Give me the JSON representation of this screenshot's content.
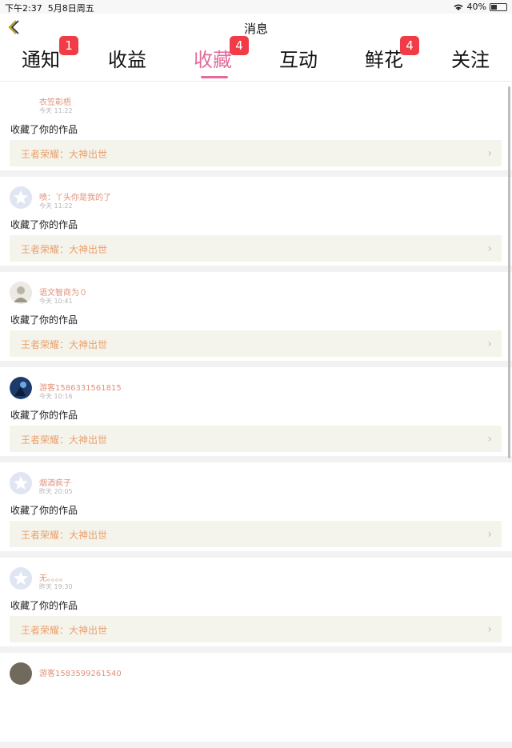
{
  "status": {
    "time": "下午2:37",
    "date": "5月8日周五",
    "battery": "40%",
    "battery_level": 0.4
  },
  "header": {
    "title": "消息",
    "back_icon": "chevron-left-icon"
  },
  "tabs": [
    {
      "label": "通知",
      "badge": "1"
    },
    {
      "label": "收益",
      "badge": ""
    },
    {
      "label": "收藏",
      "badge": "4",
      "active": true
    },
    {
      "label": "互动",
      "badge": ""
    },
    {
      "label": "鲜花",
      "badge": "4"
    },
    {
      "label": "关注",
      "badge": ""
    }
  ],
  "colors": {
    "accent": "#e36b9c",
    "badge": "#f03c46",
    "name": "#e0917a",
    "work_title": "#e9a06b",
    "work_bg": "#f5f4ec"
  },
  "items": [
    {
      "name": "衣笠彰梧",
      "time": "今天 11:22",
      "action": "收藏了你的作品",
      "work": "王者荣耀：大神出世"
    },
    {
      "name": "喷：丫头你是我的了",
      "time": "今天 11:22",
      "action": "收藏了你的作品",
      "work": "王者荣耀：大神出世"
    },
    {
      "name": "语文智商为０",
      "time": "今天 10:41",
      "action": "收藏了你的作品",
      "work": "王者荣耀：大神出世"
    },
    {
      "name": "游客1586331561815",
      "time": "今天 10:16",
      "action": "收藏了你的作品",
      "work": "王者荣耀：大神出世"
    },
    {
      "name": "烟酒疯子",
      "time": "昨天 20:05",
      "action": "收藏了你的作品",
      "work": "王者荣耀：大神出世"
    },
    {
      "name": "无。。。。",
      "time": "昨天 19:30",
      "action": "收藏了你的作品",
      "work": "王者荣耀：大神出世"
    },
    {
      "name": "游客1583599261540",
      "time": "",
      "action": "",
      "work": ""
    }
  ]
}
